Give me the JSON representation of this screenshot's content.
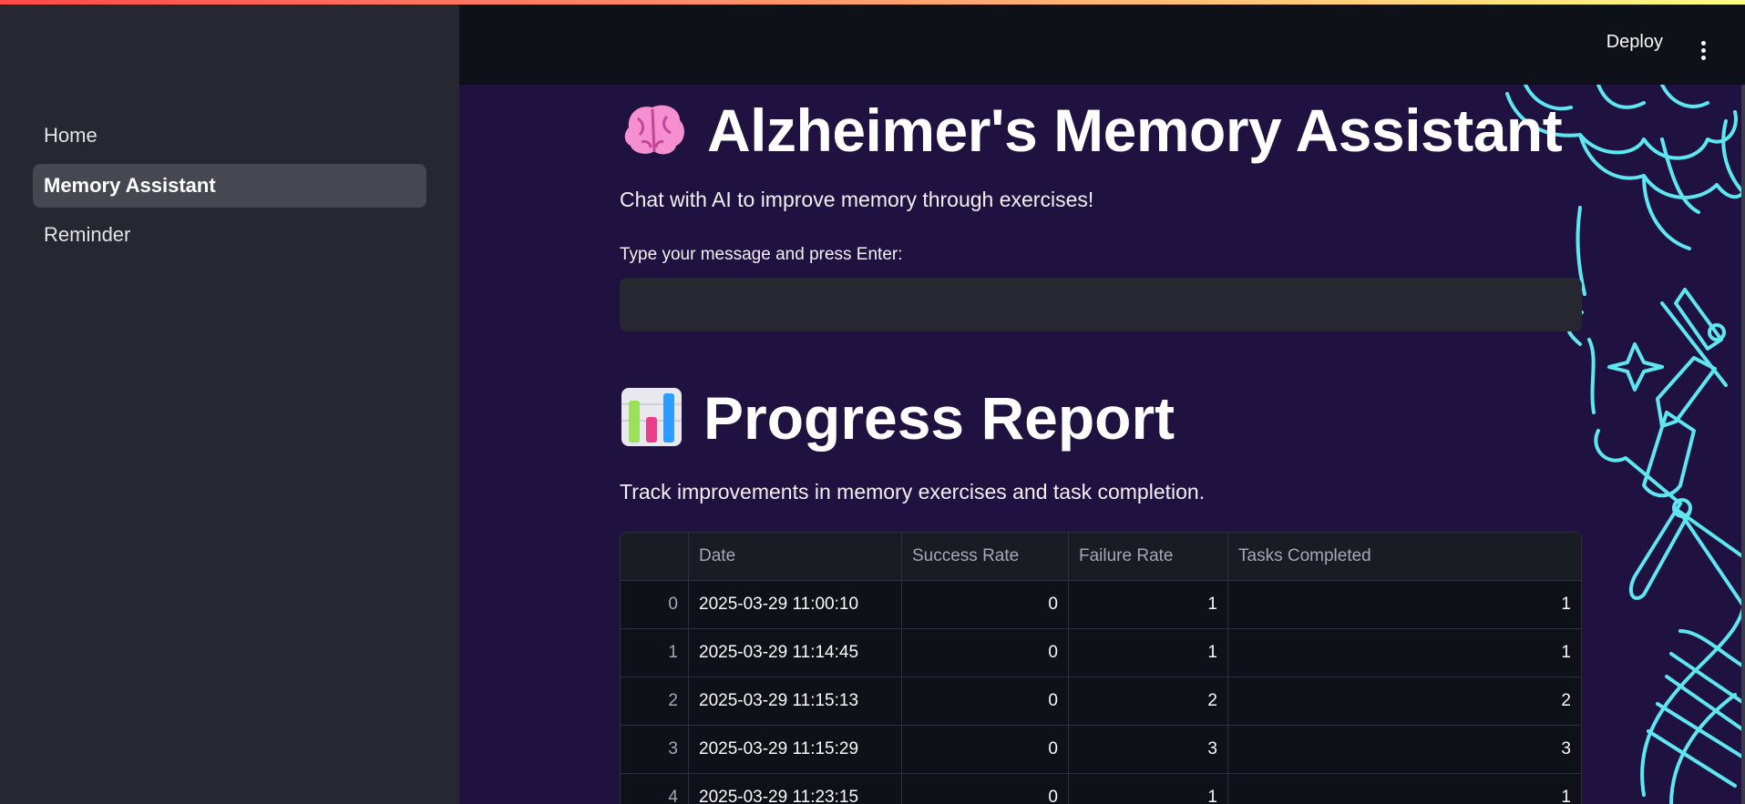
{
  "sidebar": {
    "items": [
      {
        "label": "Home",
        "active": false
      },
      {
        "label": "Memory Assistant",
        "active": true
      },
      {
        "label": "Reminder",
        "active": false
      }
    ]
  },
  "header": {
    "deploy_label": "Deploy",
    "menu_icon": "kebab-menu-icon"
  },
  "main": {
    "title": "Alzheimer's Memory Assistant",
    "title_icon": "brain-icon",
    "subtitle": "Chat with AI to improve memory through exercises!",
    "input_label": "Type your message and press Enter:",
    "input_value": "",
    "progress_title": "Progress Report",
    "progress_icon": "bar-chart-icon",
    "progress_subtitle": "Track improvements in memory exercises and task completion."
  },
  "table": {
    "columns": [
      "",
      "Date",
      "Success Rate",
      "Failure Rate",
      "Tasks Completed"
    ],
    "rows": [
      [
        "0",
        "2025-03-29 11:00:10",
        "0",
        "1",
        "1"
      ],
      [
        "1",
        "2025-03-29 11:14:45",
        "0",
        "1",
        "1"
      ],
      [
        "2",
        "2025-03-29 11:15:13",
        "0",
        "2",
        "2"
      ],
      [
        "3",
        "2025-03-29 11:15:29",
        "0",
        "3",
        "3"
      ],
      [
        "4",
        "2025-03-29 11:23:15",
        "0",
        "1",
        "1"
      ]
    ]
  },
  "colors": {
    "accent_gradient": [
      "#ff4b4b",
      "#fffd80"
    ],
    "main_background": "#1f1240",
    "sidebar_background": "#262730",
    "decoration_stroke": "#5ee7f0"
  }
}
